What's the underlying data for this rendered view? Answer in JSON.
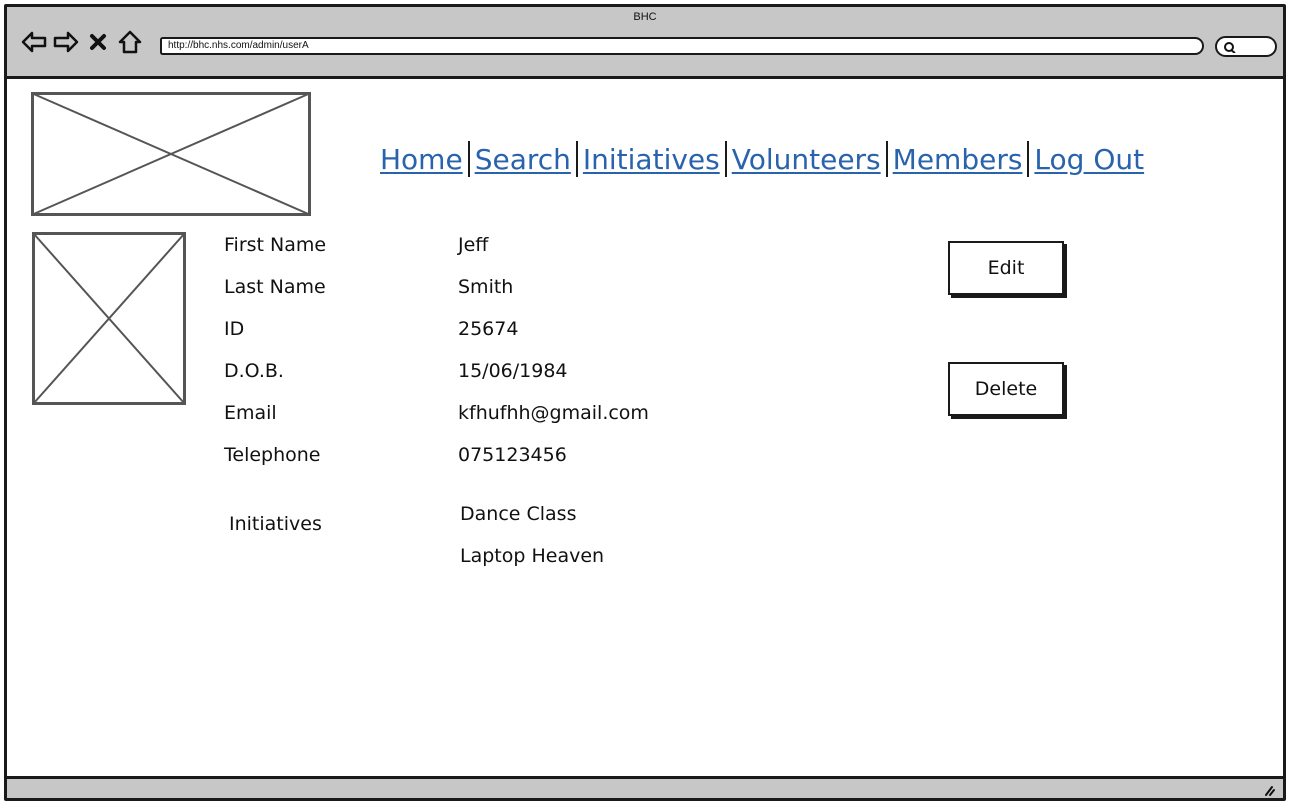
{
  "window": {
    "title": "BHC"
  },
  "browser": {
    "url": "http://bhc.nhs.com/admin/userA",
    "buttons": {
      "back": "back-arrow-icon",
      "forward": "forward-arrow-icon",
      "stop": "close-icon",
      "home": "home-icon"
    }
  },
  "nav": {
    "items": [
      "Home",
      "Search",
      "Initiatives",
      "Volunteers",
      "Members",
      "Log Out"
    ]
  },
  "profile": {
    "first_name_label": "First Name",
    "first_name": "Jeff",
    "last_name_label": "Last Name",
    "last_name": "Smith",
    "id_label": "ID",
    "id": "25674",
    "dob_label": "D.O.B.",
    "dob": "15/06/1984",
    "email_label": "Email",
    "email": "kfhufhh@gmail.com",
    "telephone_label": "Telephone",
    "telephone": "075123456",
    "initiatives_label": "Initiatives",
    "initiatives": [
      "Dance Class",
      "Laptop Heaven"
    ]
  },
  "actions": {
    "edit": "Edit",
    "delete": "Delete"
  },
  "colors": {
    "link": "#2a63ad",
    "chrome": "#c7c7c7",
    "border": "#1a1a1a"
  }
}
